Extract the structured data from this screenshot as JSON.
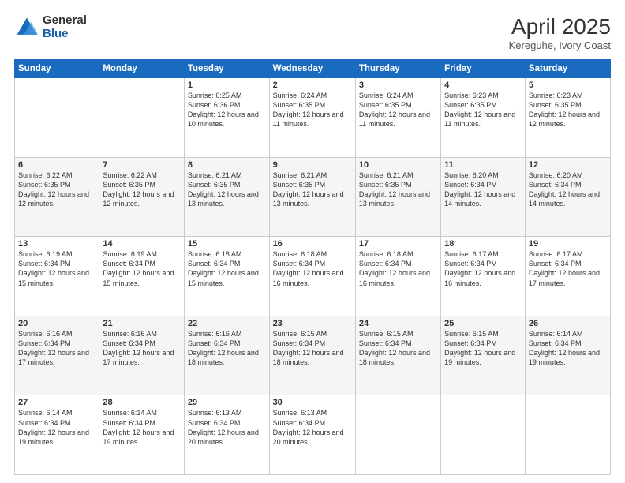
{
  "logo": {
    "general": "General",
    "blue": "Blue"
  },
  "title": "April 2025",
  "subtitle": "Kereguhe, Ivory Coast",
  "days_of_week": [
    "Sunday",
    "Monday",
    "Tuesday",
    "Wednesday",
    "Thursday",
    "Friday",
    "Saturday"
  ],
  "weeks": [
    [
      {
        "day": "",
        "info": ""
      },
      {
        "day": "",
        "info": ""
      },
      {
        "day": "1",
        "info": "Sunrise: 6:25 AM\nSunset: 6:36 PM\nDaylight: 12 hours and 10 minutes."
      },
      {
        "day": "2",
        "info": "Sunrise: 6:24 AM\nSunset: 6:35 PM\nDaylight: 12 hours and 11 minutes."
      },
      {
        "day": "3",
        "info": "Sunrise: 6:24 AM\nSunset: 6:35 PM\nDaylight: 12 hours and 11 minutes."
      },
      {
        "day": "4",
        "info": "Sunrise: 6:23 AM\nSunset: 6:35 PM\nDaylight: 12 hours and 11 minutes."
      },
      {
        "day": "5",
        "info": "Sunrise: 6:23 AM\nSunset: 6:35 PM\nDaylight: 12 hours and 12 minutes."
      }
    ],
    [
      {
        "day": "6",
        "info": "Sunrise: 6:22 AM\nSunset: 6:35 PM\nDaylight: 12 hours and 12 minutes."
      },
      {
        "day": "7",
        "info": "Sunrise: 6:22 AM\nSunset: 6:35 PM\nDaylight: 12 hours and 12 minutes."
      },
      {
        "day": "8",
        "info": "Sunrise: 6:21 AM\nSunset: 6:35 PM\nDaylight: 12 hours and 13 minutes."
      },
      {
        "day": "9",
        "info": "Sunrise: 6:21 AM\nSunset: 6:35 PM\nDaylight: 12 hours and 13 minutes."
      },
      {
        "day": "10",
        "info": "Sunrise: 6:21 AM\nSunset: 6:35 PM\nDaylight: 12 hours and 13 minutes."
      },
      {
        "day": "11",
        "info": "Sunrise: 6:20 AM\nSunset: 6:34 PM\nDaylight: 12 hours and 14 minutes."
      },
      {
        "day": "12",
        "info": "Sunrise: 6:20 AM\nSunset: 6:34 PM\nDaylight: 12 hours and 14 minutes."
      }
    ],
    [
      {
        "day": "13",
        "info": "Sunrise: 6:19 AM\nSunset: 6:34 PM\nDaylight: 12 hours and 15 minutes."
      },
      {
        "day": "14",
        "info": "Sunrise: 6:19 AM\nSunset: 6:34 PM\nDaylight: 12 hours and 15 minutes."
      },
      {
        "day": "15",
        "info": "Sunrise: 6:18 AM\nSunset: 6:34 PM\nDaylight: 12 hours and 15 minutes."
      },
      {
        "day": "16",
        "info": "Sunrise: 6:18 AM\nSunset: 6:34 PM\nDaylight: 12 hours and 16 minutes."
      },
      {
        "day": "17",
        "info": "Sunrise: 6:18 AM\nSunset: 6:34 PM\nDaylight: 12 hours and 16 minutes."
      },
      {
        "day": "18",
        "info": "Sunrise: 6:17 AM\nSunset: 6:34 PM\nDaylight: 12 hours and 16 minutes."
      },
      {
        "day": "19",
        "info": "Sunrise: 6:17 AM\nSunset: 6:34 PM\nDaylight: 12 hours and 17 minutes."
      }
    ],
    [
      {
        "day": "20",
        "info": "Sunrise: 6:16 AM\nSunset: 6:34 PM\nDaylight: 12 hours and 17 minutes."
      },
      {
        "day": "21",
        "info": "Sunrise: 6:16 AM\nSunset: 6:34 PM\nDaylight: 12 hours and 17 minutes."
      },
      {
        "day": "22",
        "info": "Sunrise: 6:16 AM\nSunset: 6:34 PM\nDaylight: 12 hours and 18 minutes."
      },
      {
        "day": "23",
        "info": "Sunrise: 6:15 AM\nSunset: 6:34 PM\nDaylight: 12 hours and 18 minutes."
      },
      {
        "day": "24",
        "info": "Sunrise: 6:15 AM\nSunset: 6:34 PM\nDaylight: 12 hours and 18 minutes."
      },
      {
        "day": "25",
        "info": "Sunrise: 6:15 AM\nSunset: 6:34 PM\nDaylight: 12 hours and 19 minutes."
      },
      {
        "day": "26",
        "info": "Sunrise: 6:14 AM\nSunset: 6:34 PM\nDaylight: 12 hours and 19 minutes."
      }
    ],
    [
      {
        "day": "27",
        "info": "Sunrise: 6:14 AM\nSunset: 6:34 PM\nDaylight: 12 hours and 19 minutes."
      },
      {
        "day": "28",
        "info": "Sunrise: 6:14 AM\nSunset: 6:34 PM\nDaylight: 12 hours and 19 minutes."
      },
      {
        "day": "29",
        "info": "Sunrise: 6:13 AM\nSunset: 6:34 PM\nDaylight: 12 hours and 20 minutes."
      },
      {
        "day": "30",
        "info": "Sunrise: 6:13 AM\nSunset: 6:34 PM\nDaylight: 12 hours and 20 minutes."
      },
      {
        "day": "",
        "info": ""
      },
      {
        "day": "",
        "info": ""
      },
      {
        "day": "",
        "info": ""
      }
    ]
  ]
}
